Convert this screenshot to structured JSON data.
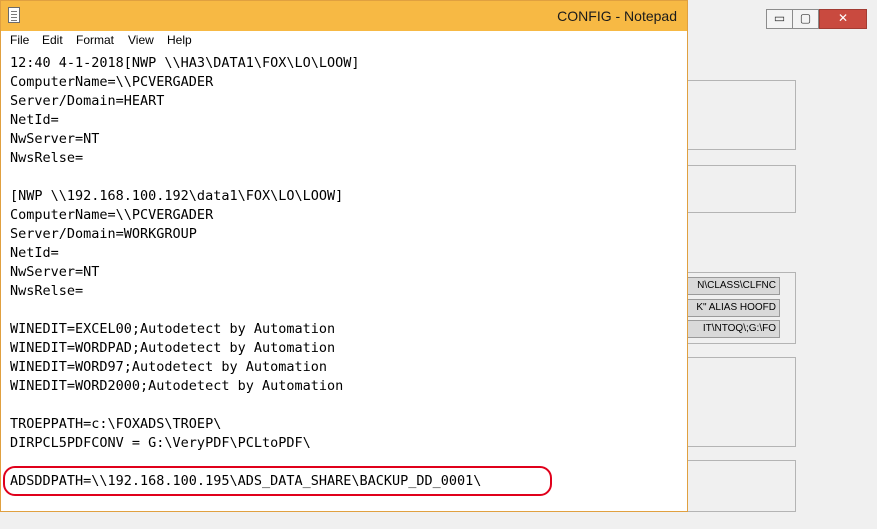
{
  "background_window": {
    "controls": {
      "minimize_glyph": "▭",
      "maximize_glyph": "▢",
      "close_glyph": "✕"
    },
    "labels": [
      "N\\CLASS\\CLFNC",
      "K\" ALIAS HOOFD",
      "IT\\NTOQ\\;G:\\FO"
    ]
  },
  "notepad": {
    "title": "CONFIG - Notepad",
    "menu": [
      "File",
      "Edit",
      "Format",
      "View",
      "Help"
    ],
    "lines": [
      "12:40 4-1-2018[NWP \\\\HA3\\DATA1\\FOX\\LO\\LOOW]",
      "ComputerName=\\\\PCVERGADER",
      "Server/Domain=HEART",
      "NetId=",
      "NwServer=NT",
      "NwsRelse=",
      "",
      "[NWP \\\\192.168.100.192\\data1\\FOX\\LO\\LOOW]",
      "ComputerName=\\\\PCVERGADER",
      "Server/Domain=WORKGROUP",
      "NetId=",
      "NwServer=NT",
      "NwsRelse=",
      "",
      "WINEDIT=EXCEL00;Autodetect by Automation",
      "WINEDIT=WORDPAD;Autodetect by Automation",
      "WINEDIT=WORD97;Autodetect by Automation",
      "WINEDIT=WORD2000;Autodetect by Automation",
      "",
      "TROEPPATH=c:\\FOXADS\\TROEP\\",
      "DIRPCL5PDFCONV = G:\\VeryPDF\\PCLtoPDF\\",
      "",
      "ADSDDPATH=\\\\192.168.100.195\\ADS_DATA_SHARE\\BACKUP_DD_0001\\"
    ]
  },
  "colors": {
    "title_bar": "#f7b944",
    "highlight": "#e0001b"
  }
}
